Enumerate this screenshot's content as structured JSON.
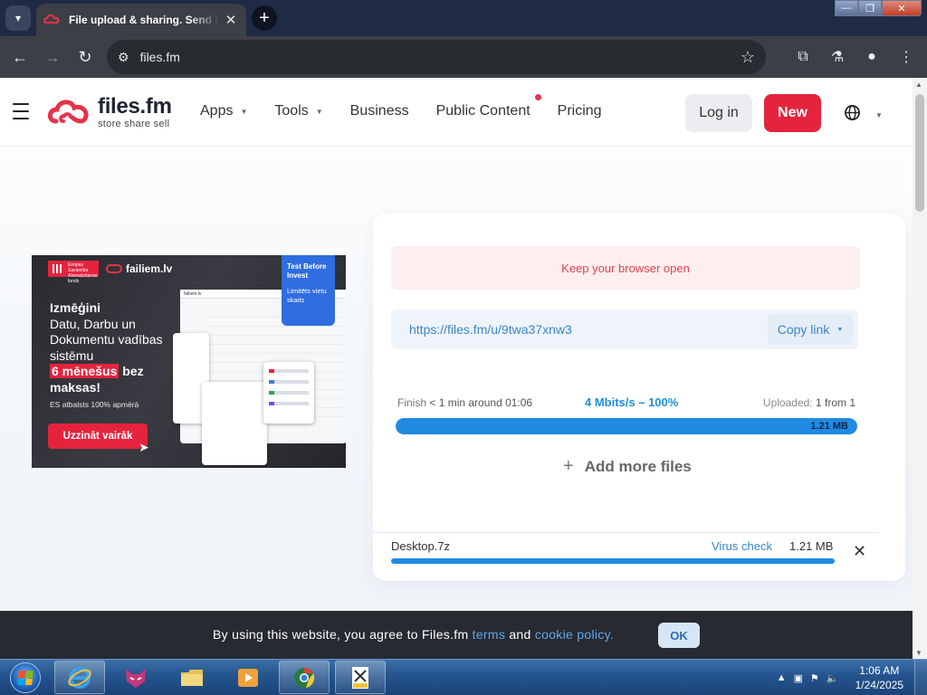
{
  "browser": {
    "tab_title": "File upload & sharing. Send large files",
    "url": "files.fm",
    "window_controls": {
      "minimize": "—",
      "maximize": "❐",
      "close": "✕"
    }
  },
  "site": {
    "logo_name": "files.fm",
    "logo_tagline": "store share sell",
    "nav": [
      {
        "label": "Apps",
        "has_caret": true
      },
      {
        "label": "Tools",
        "has_caret": true
      },
      {
        "label": "Business",
        "has_caret": false
      },
      {
        "label": "Public Content",
        "has_caret": false,
        "badge_dot": true
      },
      {
        "label": "Pricing",
        "has_caret": false
      }
    ],
    "login_label": "Log in",
    "new_label": "New",
    "accent_color": "#e5233d"
  },
  "ad": {
    "eu_badge": "Eiropas Savienība Atveseļošanas fonds",
    "brand": "failiem.lv",
    "headline_line1": "Izmēģini",
    "headline_line2": "Datu, Darbu un Dokumentu vadības sistēmu",
    "headline_highlight": "6 mēnešus",
    "headline_rest": "bez maksas!",
    "subtext": "ES atbalsts 100% apmērā",
    "cta": "Uzzināt vairāk",
    "card_title": "Test Before Invest",
    "card_sub": "Limitēts vietu skaits"
  },
  "upload": {
    "notice": "Keep your browser open",
    "share_link": "https://files.fm/u/9twa37xnw3",
    "copy_label": "Copy link",
    "finish_label": "Finish",
    "finish_value": "< 1 min around 01:06",
    "speed": "4 Mbits/s – 100%",
    "uploaded_label": "Uploaded:",
    "uploaded_value": "1 from 1",
    "progress_fraction": 1.0,
    "total_size": "1.21 MB",
    "add_more": "Add more files",
    "file": {
      "name": "Desktop.7z",
      "virus_check": "Virus check",
      "size": "1.21 MB",
      "progress_fraction": 1.0
    }
  },
  "cookie": {
    "text_before": "By using this website, you agree to Files.fm",
    "terms": "terms",
    "and": "and",
    "policy": "cookie policy.",
    "ok": "OK"
  },
  "taskbar": {
    "apps": [
      "internet-explorer",
      "fox-app",
      "file-explorer",
      "media-player",
      "chrome",
      "tiff-viewer"
    ],
    "time": "1:06 AM",
    "date": "1/24/2025"
  }
}
